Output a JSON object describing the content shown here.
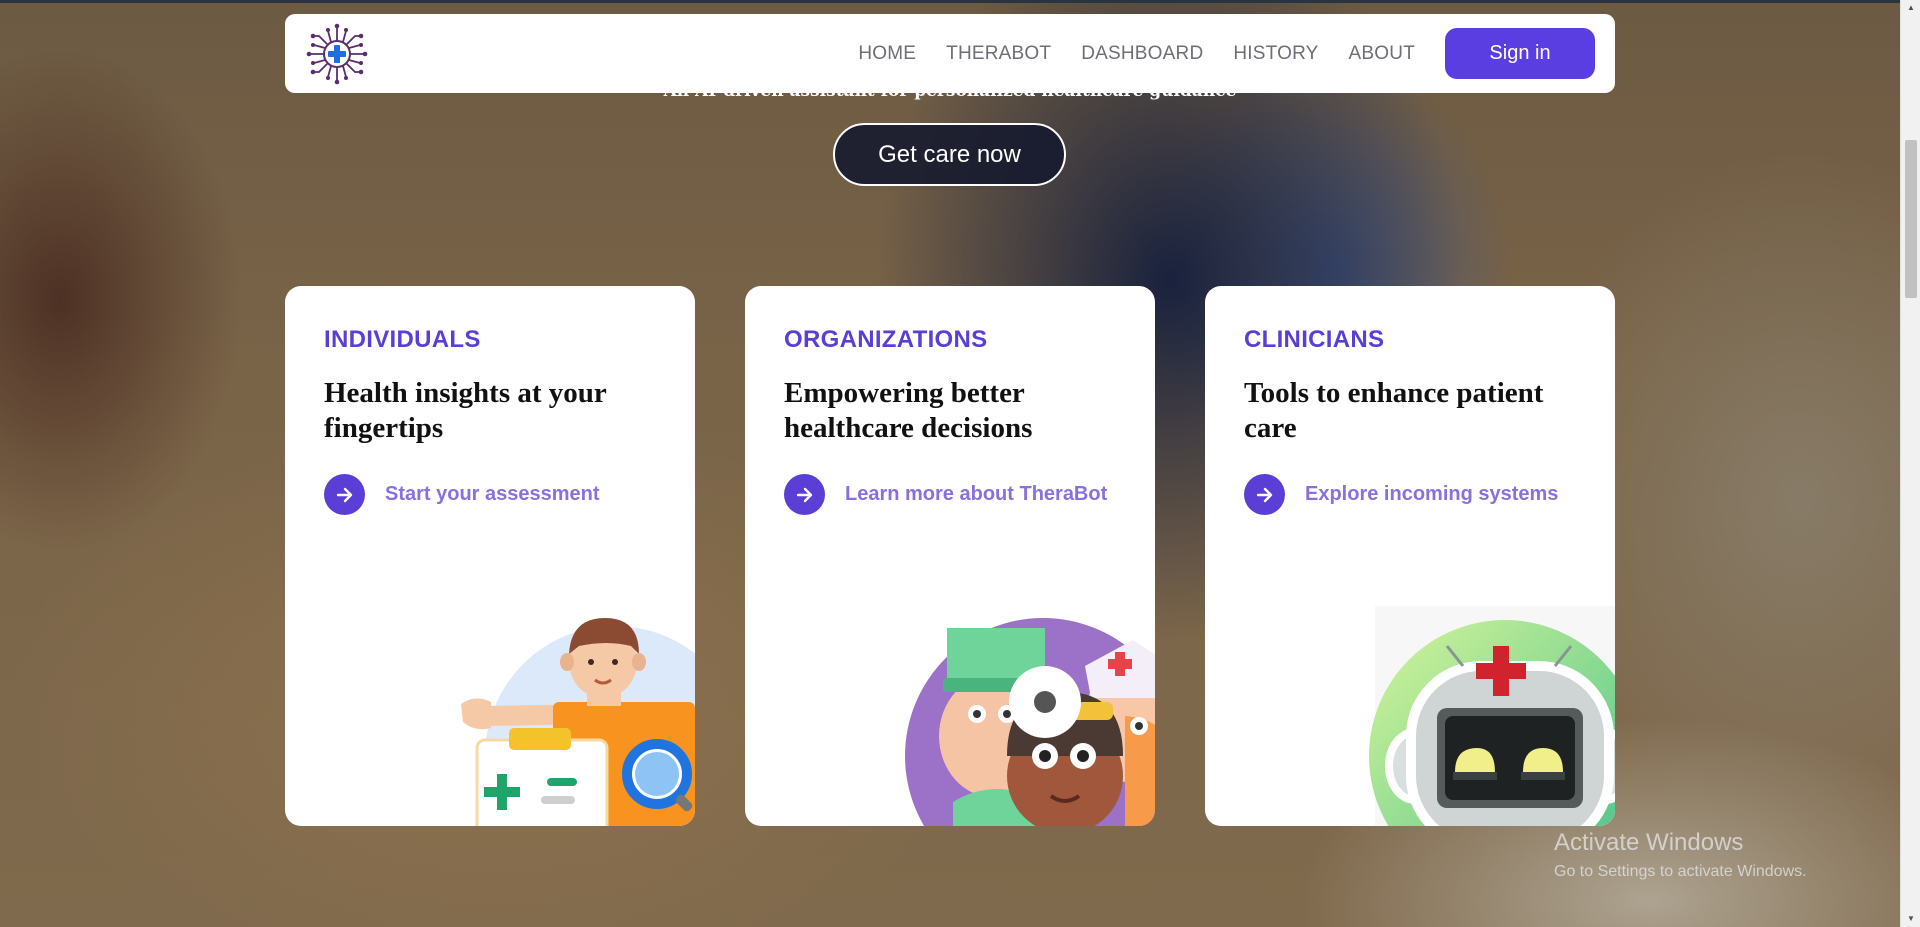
{
  "nav": {
    "links": [
      "HOME",
      "THERABOT",
      "DASHBOARD",
      "HISTORY",
      "ABOUT"
    ],
    "signin_label": "Sign in"
  },
  "hero": {
    "tagline": "An AI-driven assistant for personalized healthcare guidance",
    "cta_label": "Get care now"
  },
  "cards": [
    {
      "category": "INDIVIDUALS",
      "heading": "Health insights at your fingertips",
      "link": "Start your assessment"
    },
    {
      "category": "ORGANIZATIONS",
      "heading": "Empowering better healthcare decisions",
      "link": "Learn more about TheraBot"
    },
    {
      "category": "CLINICIANS",
      "heading": "Tools to enhance patient care",
      "link": "Explore incoming systems"
    }
  ],
  "watermark": {
    "title": "Activate Windows",
    "subtitle": "Go to Settings to activate Windows."
  },
  "colors": {
    "accent": "#5b3ed6",
    "link_text": "#8a70dc"
  },
  "icons": [
    "logo-icon",
    "arrow-right-icon",
    "chevron-up-icon",
    "chevron-down-icon"
  ]
}
